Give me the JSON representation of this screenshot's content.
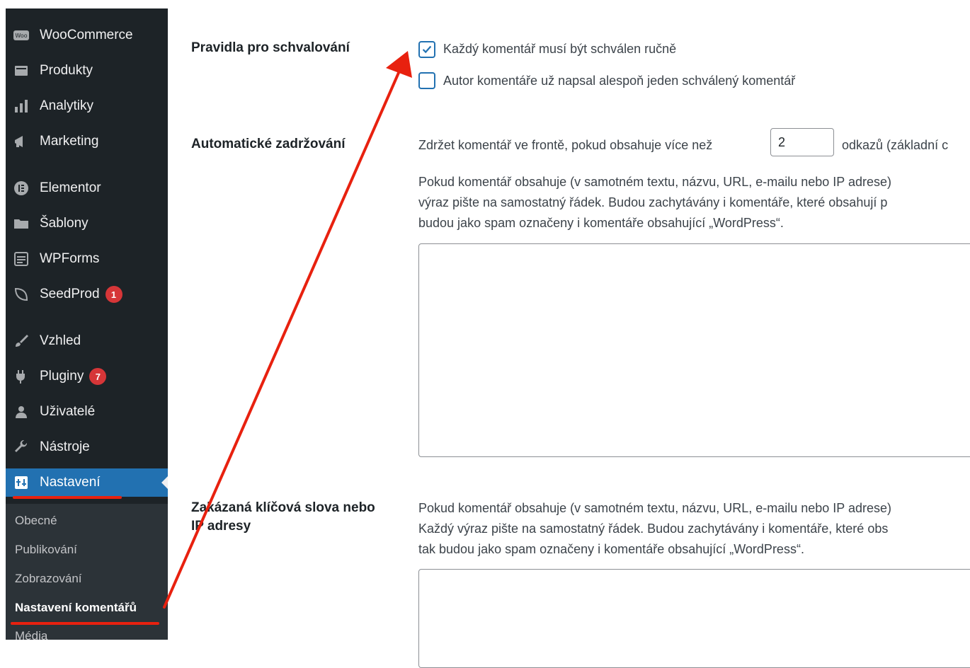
{
  "sidebar": {
    "items": [
      {
        "label": "WooCommerce",
        "icon": "woo-icon"
      },
      {
        "label": "Produkty",
        "icon": "products-icon"
      },
      {
        "label": "Analytiky",
        "icon": "analytics-icon"
      },
      {
        "label": "Marketing",
        "icon": "megaphone-icon"
      },
      {
        "label": "Elementor",
        "icon": "elementor-icon"
      },
      {
        "label": "Šablony",
        "icon": "folder-icon"
      },
      {
        "label": "WPForms",
        "icon": "wpforms-icon"
      },
      {
        "label": "SeedProd",
        "icon": "seedprod-icon",
        "badge": "1"
      },
      {
        "label": "Vzhled",
        "icon": "brush-icon"
      },
      {
        "label": "Pluginy",
        "icon": "plugin-icon",
        "badge": "7"
      },
      {
        "label": "Uživatelé",
        "icon": "users-icon"
      },
      {
        "label": "Nástroje",
        "icon": "wrench-icon"
      },
      {
        "label": "Nastavení",
        "icon": "settings-icon",
        "active": true
      }
    ],
    "submenu": [
      {
        "label": "Obecné"
      },
      {
        "label": "Publikování"
      },
      {
        "label": "Zobrazování"
      },
      {
        "label": "Nastavení komentářů",
        "current": true
      },
      {
        "label": "Média"
      }
    ]
  },
  "colors": {
    "sidebar_bg": "#1d2327",
    "active_bg": "#2271b1",
    "badge_seedprod": "#d63638",
    "badge_plugins": "#d63638",
    "annotation": "#e8210f"
  },
  "settings": {
    "approval": {
      "label": "Pravidla pro schvalování",
      "options": [
        {
          "label": "Každý komentář musí být schválen ručně",
          "checked": true
        },
        {
          "label": "Autor komentáře už napsal alespoň jeden schválený komentář",
          "checked": false
        }
      ]
    },
    "moderation": {
      "label": "Automatické zadržování",
      "hold_prefix": "Zdržet komentář ve frontě, pokud obsahuje více než",
      "links_value": "2",
      "hold_suffix": "odkazů (základní c",
      "desc": [
        "Pokud komentář obsahuje (v samotném textu, názvu, URL, e-mailu nebo IP adrese)",
        "výraz pište na samostatný řádek. Budou zachytávány i komentáře, které obsahují p",
        "budou jako spam označeny i komentáře obsahující „WordPress“."
      ],
      "textarea_value": ""
    },
    "disallowed": {
      "label_line1": "Zakázaná klíčová slova nebo",
      "label_line2": "IP adresy",
      "desc": [
        "Pokud komentář obsahuje (v samotném textu, názvu, URL, e-mailu nebo IP adrese)",
        "Každý výraz pište na samostatný řádek. Budou zachytávány i komentáře, které obs",
        "tak budou jako spam označeny i komentáře obsahující „WordPress“."
      ],
      "textarea_value": ""
    }
  }
}
